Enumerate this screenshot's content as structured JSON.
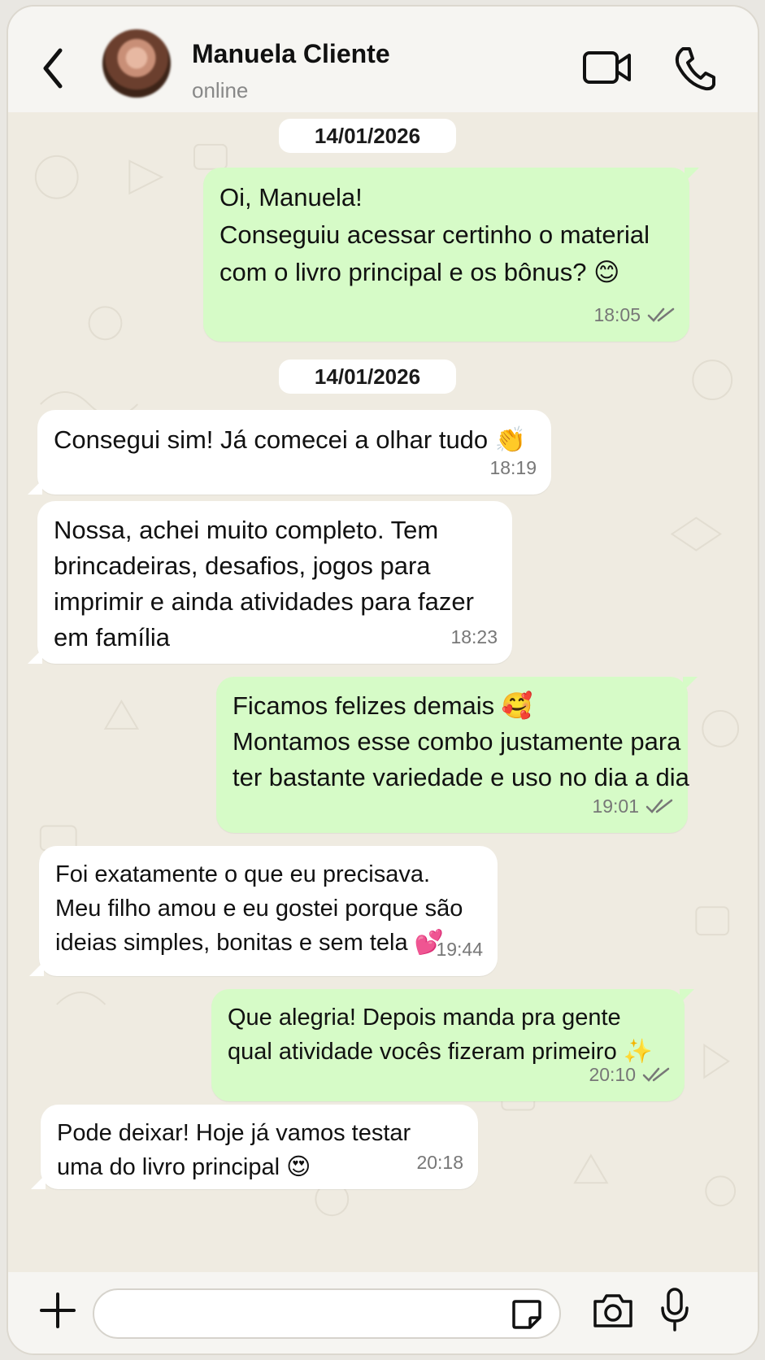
{
  "header": {
    "contact_name": "Manuela Cliente",
    "status": "online"
  },
  "messages": [
    {
      "type": "date",
      "text": "14/01/2026"
    },
    {
      "type": "out",
      "lines": [
        "Oi, Manuela!",
        "Conseguiu acessar certinho o material",
        "com o livro principal e os bônus? 😊"
      ],
      "time": "18:05",
      "read": true
    },
    {
      "type": "date",
      "text": "14/01/2026"
    },
    {
      "type": "in",
      "lines": [
        "Consegui sim! Já comecei a olhar tudo 👏"
      ],
      "time": "18:19"
    },
    {
      "type": "in",
      "lines": [
        "Nossa, achei muito completo. Tem",
        "brincadeiras, desafios, jogos para",
        "imprimir e ainda atividades para fazer",
        "em família"
      ],
      "time": "18:23"
    },
    {
      "type": "out",
      "lines": [
        "Ficamos felizes demais 🥰",
        "Montamos esse combo justamente para",
        "ter bastante variedade e uso no dia a dia"
      ],
      "time": "19:01",
      "read": true
    },
    {
      "type": "in",
      "lines": [
        "Foi exatamente o que eu precisava.",
        "Meu filho amou e eu gostei porque são",
        "ideias simples, bonitas e sem tela 💕"
      ],
      "time": "19:44"
    },
    {
      "type": "out",
      "lines": [
        "Que alegria! Depois manda pra gente",
        "qual atividade vocês fizeram primeiro ✨"
      ],
      "time": "20:10",
      "read": true
    },
    {
      "type": "in",
      "lines": [
        "Pode deixar! Hoje já vamos testar",
        "uma do livro principal 😍"
      ],
      "time": "20:18"
    }
  ],
  "composer": {
    "value": "",
    "placeholder": ""
  },
  "colors": {
    "outgoing_bubble": "#d6fbc7",
    "incoming_bubble": "#ffffff",
    "wallpaper": "#efebe1"
  },
  "icons": [
    "back-arrow-icon",
    "video-call-icon",
    "phone-icon",
    "plus-icon",
    "sticker-icon",
    "camera-icon",
    "microphone-icon",
    "double-check-icon"
  ]
}
